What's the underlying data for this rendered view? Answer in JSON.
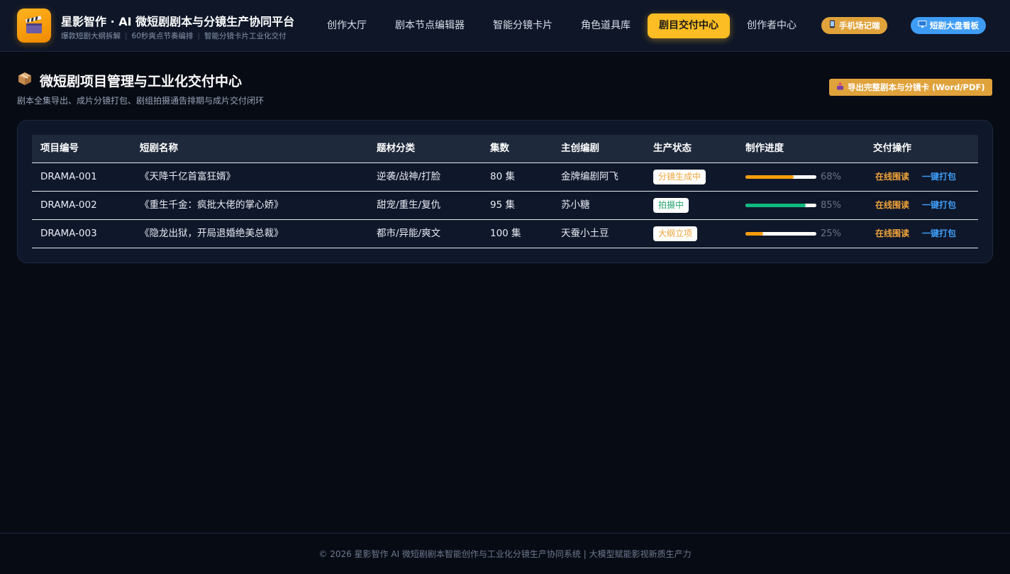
{
  "header": {
    "logo_icon": "clapperboard-icon",
    "title": "星影智作 · AI 微短剧剧本与分镜生产协同平台",
    "subtitle_parts": [
      "爆款短剧大纲拆解",
      "60秒爽点节奏编排",
      "智能分镜卡片工业化交付"
    ],
    "nav": [
      {
        "label": "创作大厅",
        "active": false
      },
      {
        "label": "剧本节点编辑器",
        "active": false
      },
      {
        "label": "智能分镜卡片",
        "active": false
      },
      {
        "label": "角色道具库",
        "active": false
      },
      {
        "label": "剧目交付中心",
        "active": true
      },
      {
        "label": "创作者中心",
        "active": false
      }
    ],
    "mobile_button": {
      "icon": "phone-icon",
      "label": "手机场记端"
    },
    "dashboard_button": {
      "icon": "monitor-icon",
      "label": "短剧大盘看板"
    }
  },
  "section": {
    "icon": "package-icon",
    "title": "微短剧项目管理与工业化交付中心",
    "subtitle": "剧本全集导出、成片分镜打包、剧组拍摄通告排期与成片交付闭环",
    "export_button": {
      "icon": "export-icon",
      "label": "导出完整剧本与分镜卡 (Word/PDF)"
    }
  },
  "table": {
    "columns": [
      "项目编号",
      "短剧名称",
      "题材分类",
      "集数",
      "主创编剧",
      "生产状态",
      "制作进度",
      "交付操作"
    ],
    "rows": [
      {
        "id": "DRAMA-001",
        "name": "《天降千亿首富狂婿》",
        "genre": "逆袭/战神/打脸",
        "episodes": "80 集",
        "writer": "金牌编剧阿飞",
        "status": "分镜生成中",
        "status_color": "#f0a33a",
        "progress": 68,
        "progress_label": "68%",
        "progress_color": "#f59e0b",
        "read_label": "在线围读",
        "pack_label": "一键打包"
      },
      {
        "id": "DRAMA-002",
        "name": "《重生千金：疯批大佬的掌心娇》",
        "genre": "甜宠/重生/复仇",
        "episodes": "95 集",
        "writer": "苏小糖",
        "status": "拍摄中",
        "status_color": "#22a36b",
        "progress": 85,
        "progress_label": "85%",
        "progress_color": "#10b981",
        "read_label": "在线围读",
        "pack_label": "一键打包"
      },
      {
        "id": "DRAMA-003",
        "name": "《隐龙出狱，开局退婚绝美总裁》",
        "genre": "都市/异能/爽文",
        "episodes": "100 集",
        "writer": "天蚕小土豆",
        "status": "大纲立项",
        "status_color": "#f0a33a",
        "progress": 25,
        "progress_label": "25%",
        "progress_color": "#f59e0b",
        "read_label": "在线围读",
        "pack_label": "一键打包"
      }
    ]
  },
  "footer": {
    "text": "© 2026 星影智作 AI 微短剧剧本智能创作与工业化分镜生产协同系统 | 大模型赋能影视新质生产力"
  }
}
